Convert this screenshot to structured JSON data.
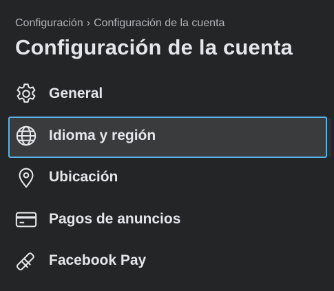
{
  "breadcrumb": {
    "parent": "Configuración",
    "separator": "›",
    "current": "Configuración de la cuenta"
  },
  "page_title": "Configuración de la cuenta",
  "colors": {
    "background": "#242526",
    "text": "#e4e6eb",
    "secondary_text": "#b0b3b8",
    "selected_background": "#3a3b3c",
    "focus_outline": "#5ab2e8"
  },
  "menu": {
    "items": [
      {
        "label": "General",
        "icon": "gear-icon",
        "selected": false
      },
      {
        "label": "Idioma y región",
        "icon": "globe-icon",
        "selected": true
      },
      {
        "label": "Ubicación",
        "icon": "location-pin-icon",
        "selected": false
      },
      {
        "label": "Pagos de anuncios",
        "icon": "credit-card-icon",
        "selected": false
      },
      {
        "label": "Facebook Pay",
        "icon": "payment-card-icon",
        "selected": false
      }
    ]
  }
}
